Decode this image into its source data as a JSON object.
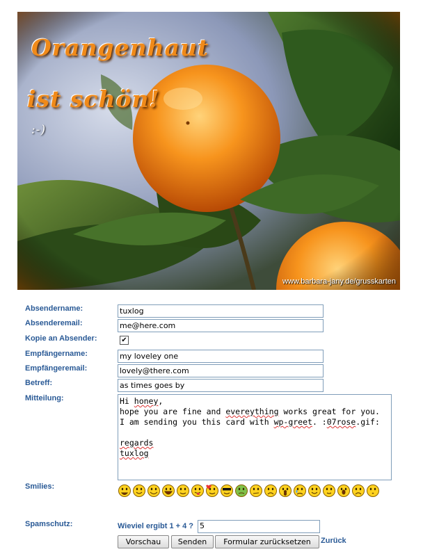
{
  "card": {
    "title_line1": "Orangenhaut",
    "title_line2": "ist schön!",
    "title_line3": ":-)",
    "watermark": "www.barbara-jany.de/grusskarten"
  },
  "form": {
    "sender_name_label": "Absendername:",
    "sender_name_value": "tuxlog",
    "sender_email_label": "Absenderemail:",
    "sender_email_value": "me@here.com",
    "copy_label": "Kopie an Absender:",
    "copy_checked": "✔",
    "recipient_name_label": "Empfängername:",
    "recipient_name_value": "my loveley one",
    "recipient_email_label": "Empfängeremail:",
    "recipient_email_value": "lovely@there.com",
    "subject_label": "Betreff:",
    "subject_value": "as times goes by",
    "message_label": "Mitteilung:",
    "message_lines": [
      "Hi honey,",
      "hope you are fine and evereything works great for you.",
      "I am sending you this card with wp-greet. :07rose.gif:",
      "",
      "regards",
      "tuxlog"
    ],
    "smilies_label": "Smilies:",
    "spam_label": "Spamschutz:",
    "spam_question": "Wieviel ergibt 1 + 4 ?",
    "spam_answer": "5",
    "preview_button": "Vorschau",
    "send_button": "Senden",
    "reset_button": "Formular zurücksetzen",
    "back_link": "Zurück"
  },
  "smilies": [
    "grin-icon",
    "smile-icon",
    "happy-icon",
    "laugh-icon",
    "wink-icon",
    "tongue-icon",
    "love-icon",
    "cool-icon",
    "sick-icon",
    "confused-icon",
    "angry-icon",
    "surprised-icon",
    "crying-icon",
    "wave-icon",
    "shy-icon",
    "shocked-icon",
    "sad-icon",
    "kiss-icon"
  ],
  "colors": {
    "label": "#2a5a96",
    "accent": "#f08a1a"
  }
}
